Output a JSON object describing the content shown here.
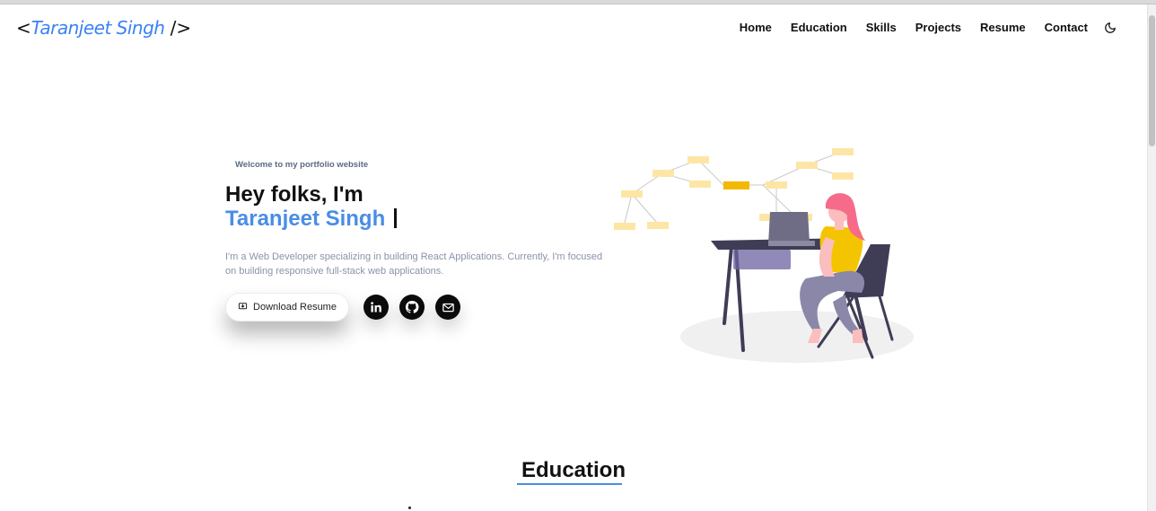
{
  "logo": {
    "open": "<",
    "name": "Taranjeet Singh",
    "close": "/>"
  },
  "nav": {
    "items": [
      "Home",
      "Education",
      "Skills",
      "Projects",
      "Resume",
      "Contact"
    ],
    "theme_toggle_icon": "moon-icon"
  },
  "hero": {
    "welcome": "Welcome to my portfolio website",
    "greeting": "Hey folks, I'm",
    "name": "Taranjeet Singh",
    "description": "I'm a Web Developer specializing in building React Applications. Currently, I'm focused on building responsive full-stack web applications.",
    "download_label": "Download Resume",
    "download_icon": "download-icon",
    "socials": [
      "linkedin-icon",
      "github-icon",
      "mail-icon"
    ]
  },
  "illustration": "woman-at-desk-with-laptop",
  "education": {
    "title": "Education"
  },
  "colors": {
    "accent": "#4a8de6",
    "text": "#111111",
    "muted": "#8a93a8",
    "illustration_yellow": "#f5c400",
    "illustration_pink": "#f76b8a"
  }
}
